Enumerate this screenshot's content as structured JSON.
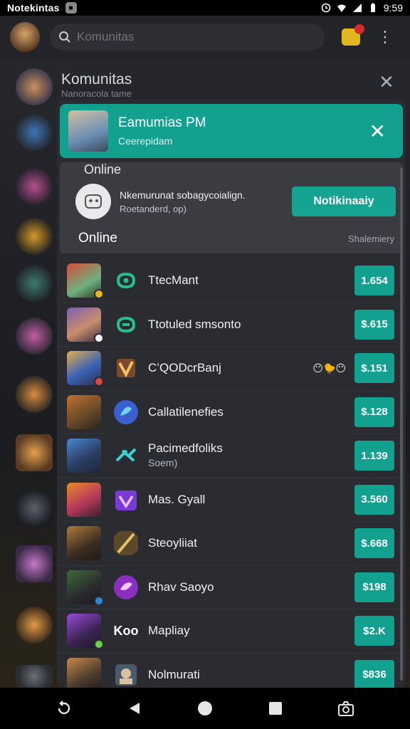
{
  "status_bar": {
    "app_name": "Notekintas",
    "time": "9:59",
    "icons": [
      "alarm-icon",
      "wifi-icon",
      "signal-icon",
      "battery-icon"
    ]
  },
  "app_bar": {
    "search_placeholder": "Komunitas"
  },
  "background": {
    "title": "Komunitas",
    "subtitle": "Nanoracola tame"
  },
  "banner": {
    "title": "Eamumias PM",
    "subtitle": "Ceerepidam"
  },
  "online_card": {
    "label": "Online",
    "notice_line1": "Nkemurunat sobagycoialign.",
    "notice_line2": "Roetanderd, op)",
    "notify_button": "Notikinaaiy",
    "section_label": "Online",
    "summary_label": "Shalemiery"
  },
  "players": [
    {
      "name": "TtecMant",
      "sub": "",
      "price": "1.654",
      "emojis": ""
    },
    {
      "name": "Ttotuled smsonto",
      "sub": "",
      "price": "$.615",
      "emojis": ""
    },
    {
      "name": "C’QODcrBanj",
      "sub": "",
      "price": "$.151",
      "emojis": "😶🐤😶"
    },
    {
      "name": "Callatilenefies",
      "sub": "",
      "price": "$.128",
      "emojis": ""
    },
    {
      "name": "Pacimedfoliks",
      "sub": "Soem)",
      "price": "1.139",
      "emojis": ""
    },
    {
      "name": "Mas. Gyall",
      "sub": "",
      "price": "3.560",
      "emojis": ""
    },
    {
      "name": "Steoyliiat",
      "sub": "",
      "price": "$.668",
      "emojis": ""
    },
    {
      "name": "Rhav Saoyo",
      "sub": "",
      "price": "$198",
      "emojis": ""
    },
    {
      "name": "Mapliay",
      "sub": "",
      "price": "$2.K",
      "emojis": ""
    },
    {
      "name": "Nolmurati",
      "sub": "",
      "price": "$836",
      "emojis": ""
    }
  ],
  "emblem_text": {
    "row9": "Koo"
  },
  "colors": {
    "accent": "#12a08f",
    "banner": "#12a08f",
    "sheet": "#2b2c31",
    "background": "#1f2024"
  }
}
